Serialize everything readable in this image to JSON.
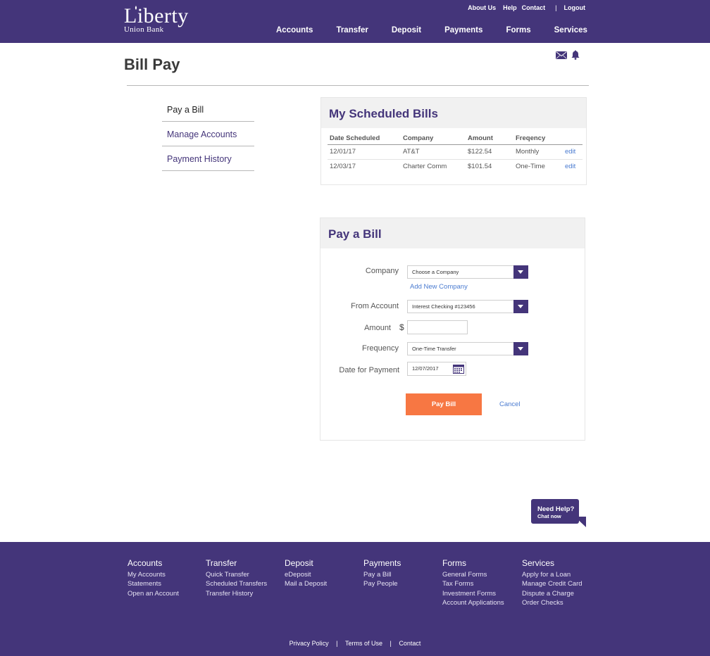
{
  "brand": {
    "name": "Liberty",
    "sub": "Union Bank"
  },
  "utility": {
    "about": "About Us",
    "help": "Help",
    "contact": "Contact",
    "sep": "|",
    "logout": "Logout"
  },
  "nav": [
    "Accounts",
    "Transfer",
    "Deposit",
    "Payments",
    "Forms",
    "Services"
  ],
  "page": {
    "title": "Bill Pay"
  },
  "sidebar": {
    "items": [
      "Pay a Bill",
      "Manage Accounts",
      "Payment History"
    ],
    "active": "Pay a Bill"
  },
  "scheduled": {
    "title": "My Scheduled Bills",
    "columns": [
      "Date Scheduled",
      "Company",
      "Amount",
      "Freqency",
      ""
    ],
    "rows": [
      {
        "date": "12/01/17",
        "company": "AT&T",
        "amount": "$122.54",
        "frequency": "Monthly",
        "action": "edit"
      },
      {
        "date": "12/03/17",
        "company": "Charter Comm",
        "amount": "$101.54",
        "frequency": "One-Time",
        "action": "edit"
      }
    ]
  },
  "paybill": {
    "title": "Pay a Bill",
    "company_label": "Company",
    "company_value": "Choose a Company",
    "add_company": "Add New Company",
    "from_label": "From Account",
    "from_value": "Interest Checking #123456",
    "amount_label": "Amount",
    "currency": "$",
    "amount_value": "",
    "frequency_label": "Frequency",
    "frequency_value": "One-Time Transfer",
    "date_label": "Date for Payment",
    "date_value": "12/07/2017",
    "pay_button": "Pay Bill",
    "cancel": "Cancel"
  },
  "help": {
    "title": "Need Help?",
    "sub": "Chat now"
  },
  "footer": {
    "columns": [
      {
        "heading": "Accounts",
        "links": [
          "My Accounts",
          "Statements",
          "Open an Account"
        ]
      },
      {
        "heading": "Transfer",
        "links": [
          "Quick Transfer",
          "Scheduled Transfers",
          "Transfer History"
        ]
      },
      {
        "heading": "Deposit",
        "links": [
          "eDeposit",
          "Mail a Deposit"
        ]
      },
      {
        "heading": "Payments",
        "links": [
          "Pay a Bill",
          "Pay People"
        ]
      },
      {
        "heading": "Forms",
        "links": [
          "General Forms",
          "Tax Forms",
          "Investment Forms",
          "Account Applications"
        ]
      },
      {
        "heading": "Services",
        "links": [
          "Apply for a Loan",
          "Manage Credit Card",
          "Dispute a Charge",
          "Order Checks"
        ]
      }
    ],
    "legal": {
      "privacy": "Privacy Policy",
      "terms": "Terms of Use",
      "contact": "Contact",
      "sep": "|"
    }
  },
  "colors": {
    "brand": "#44357a",
    "accent": "#f77743",
    "link": "#4a7bd0"
  },
  "icons": [
    "torch-icon",
    "mail-icon",
    "bell-icon",
    "chevron-down-icon",
    "calendar-icon"
  ]
}
